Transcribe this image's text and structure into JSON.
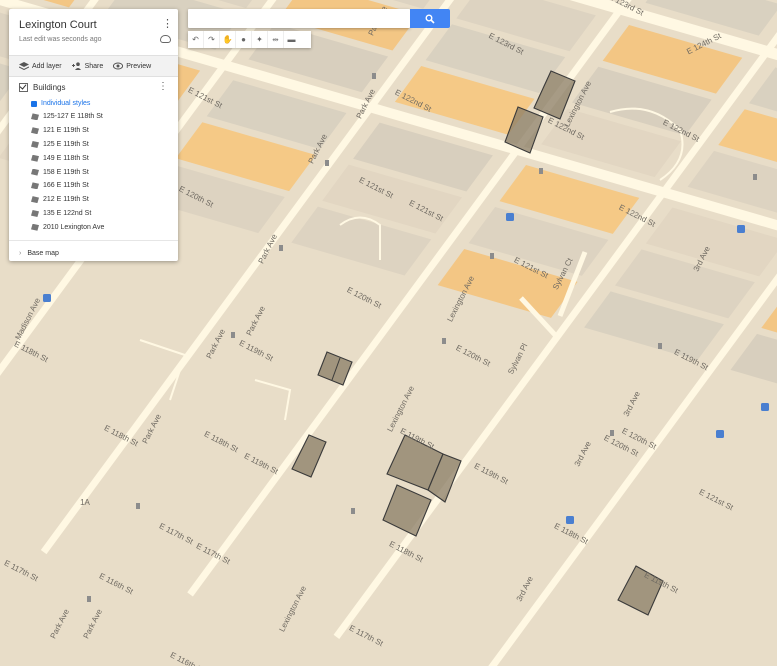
{
  "panel": {
    "title": "Lexington Court",
    "subtitle": "Last edit was seconds ago",
    "actions": {
      "add_layer": "Add layer",
      "share": "Share",
      "preview": "Preview"
    },
    "layer": {
      "name": "Buildings",
      "style": "Individual styles",
      "items": [
        "125-127 E 118th St",
        "121 E 119th St",
        "125 E 119th St",
        "149 E 118th St",
        "158 E 119th St",
        "166 E 119th St",
        "212 E 119th St",
        "135 E 122nd St",
        "2010 Lexington Ave"
      ]
    },
    "base_map": "Base map"
  },
  "toolbar": {
    "icons": [
      "undo-icon",
      "redo-icon",
      "hand-icon",
      "marker-icon",
      "polygon-icon",
      "route-icon",
      "measure-icon"
    ]
  },
  "map": {
    "colors": {
      "background": "#e8ddc8",
      "street": "#fff8e3",
      "building": "#ddd3c1",
      "highlight": "#f5c986",
      "shape": "#8a7c66"
    },
    "street_labels": [
      {
        "text": "E 124th St"
      },
      {
        "text": "E 123rd St"
      },
      {
        "text": "E 123rd St"
      },
      {
        "text": "E 122nd St"
      },
      {
        "text": "E 122nd St"
      },
      {
        "text": "E 121st St"
      },
      {
        "text": "E 121st St"
      },
      {
        "text": "E 122nd St"
      },
      {
        "text": "E 122nd St"
      },
      {
        "text": "E 121st St"
      },
      {
        "text": "E 121st St"
      },
      {
        "text": "E 120th St"
      },
      {
        "text": "E 120th St"
      },
      {
        "text": "E 120th St"
      },
      {
        "text": "E 120th St"
      },
      {
        "text": "E 119th St"
      },
      {
        "text": "E 119th St"
      },
      {
        "text": "E 119th St"
      },
      {
        "text": "E 119th St"
      },
      {
        "text": "E 119th St"
      },
      {
        "text": "E 118th St"
      },
      {
        "text": "E 118th St"
      },
      {
        "text": "E 118th St"
      },
      {
        "text": "E 118th St"
      },
      {
        "text": "E 118th St"
      },
      {
        "text": "E 117th St"
      },
      {
        "text": "E 117th St"
      },
      {
        "text": "E 117th St"
      },
      {
        "text": "E 116th St"
      },
      {
        "text": "E 117th St"
      },
      {
        "text": "E 116th St"
      },
      {
        "text": "E 120th St"
      },
      {
        "text": "E 119th St"
      },
      {
        "text": "E 121st St"
      },
      {
        "text": "Park Ave"
      },
      {
        "text": "Park Ave"
      },
      {
        "text": "Park Ave"
      },
      {
        "text": "Park Ave"
      },
      {
        "text": "Park Ave"
      },
      {
        "text": "Park Ave"
      },
      {
        "text": "Park Ave"
      },
      {
        "text": "Park Ave"
      },
      {
        "text": "Park Ave"
      },
      {
        "text": "Lexington Ave"
      },
      {
        "text": "Lexington Ave"
      },
      {
        "text": "Lexington Ave"
      },
      {
        "text": "Lexington Ave"
      },
      {
        "text": "3rd Ave"
      },
      {
        "text": "3rd Ave"
      },
      {
        "text": "3rd Ave"
      },
      {
        "text": "3rd Ave"
      },
      {
        "text": "Madison Ave"
      },
      {
        "text": "Sylvan Ct"
      },
      {
        "text": "Sylvan Pl"
      },
      {
        "text": "1A"
      }
    ]
  }
}
